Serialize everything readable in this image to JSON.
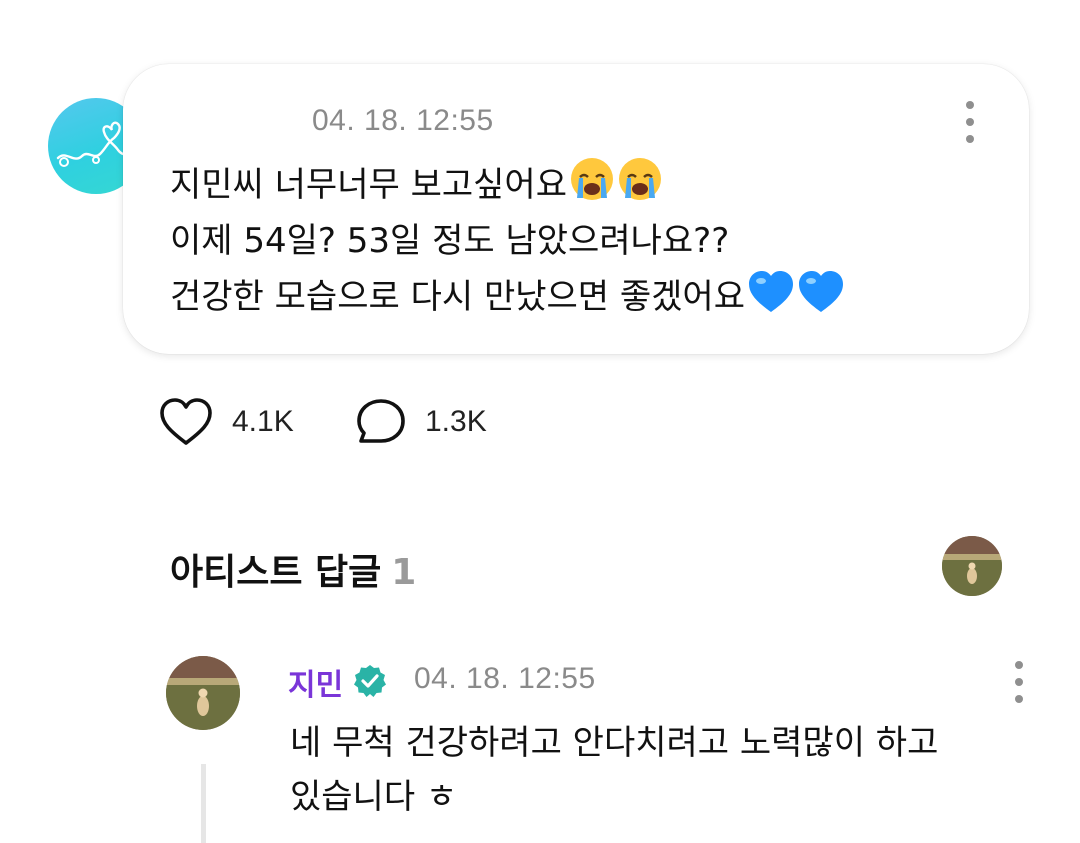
{
  "post": {
    "time": "04. 18. 12:55",
    "lines": [
      {
        "text": "지민씨 너무너무 보고싶어요",
        "emoji": [
          "crying-face",
          "crying-face"
        ]
      },
      {
        "text": "이제 54일? 53일 정도 남았으려나요??",
        "emoji": []
      },
      {
        "text": "건강한 모습으로 다시 만났으면 좋겠어요",
        "emoji": [
          "blue-heart",
          "blue-heart"
        ]
      }
    ],
    "like_count": "4.1K",
    "comment_count": "1.3K"
  },
  "artist_replies": {
    "title": "아티스트 답글",
    "count": "1"
  },
  "reply": {
    "author": "지민",
    "time": "04. 18. 12:55",
    "lines": [
      "네 무척 건강하려고 안다치려고 노력많이 하고",
      "있습니다 ㅎ"
    ]
  },
  "colors": {
    "accent_purple": "#7a35d8",
    "verified_teal": "#2ab3a6",
    "avatar_cyan": "#35d0e0",
    "heart_blue": "#1e90ff"
  }
}
